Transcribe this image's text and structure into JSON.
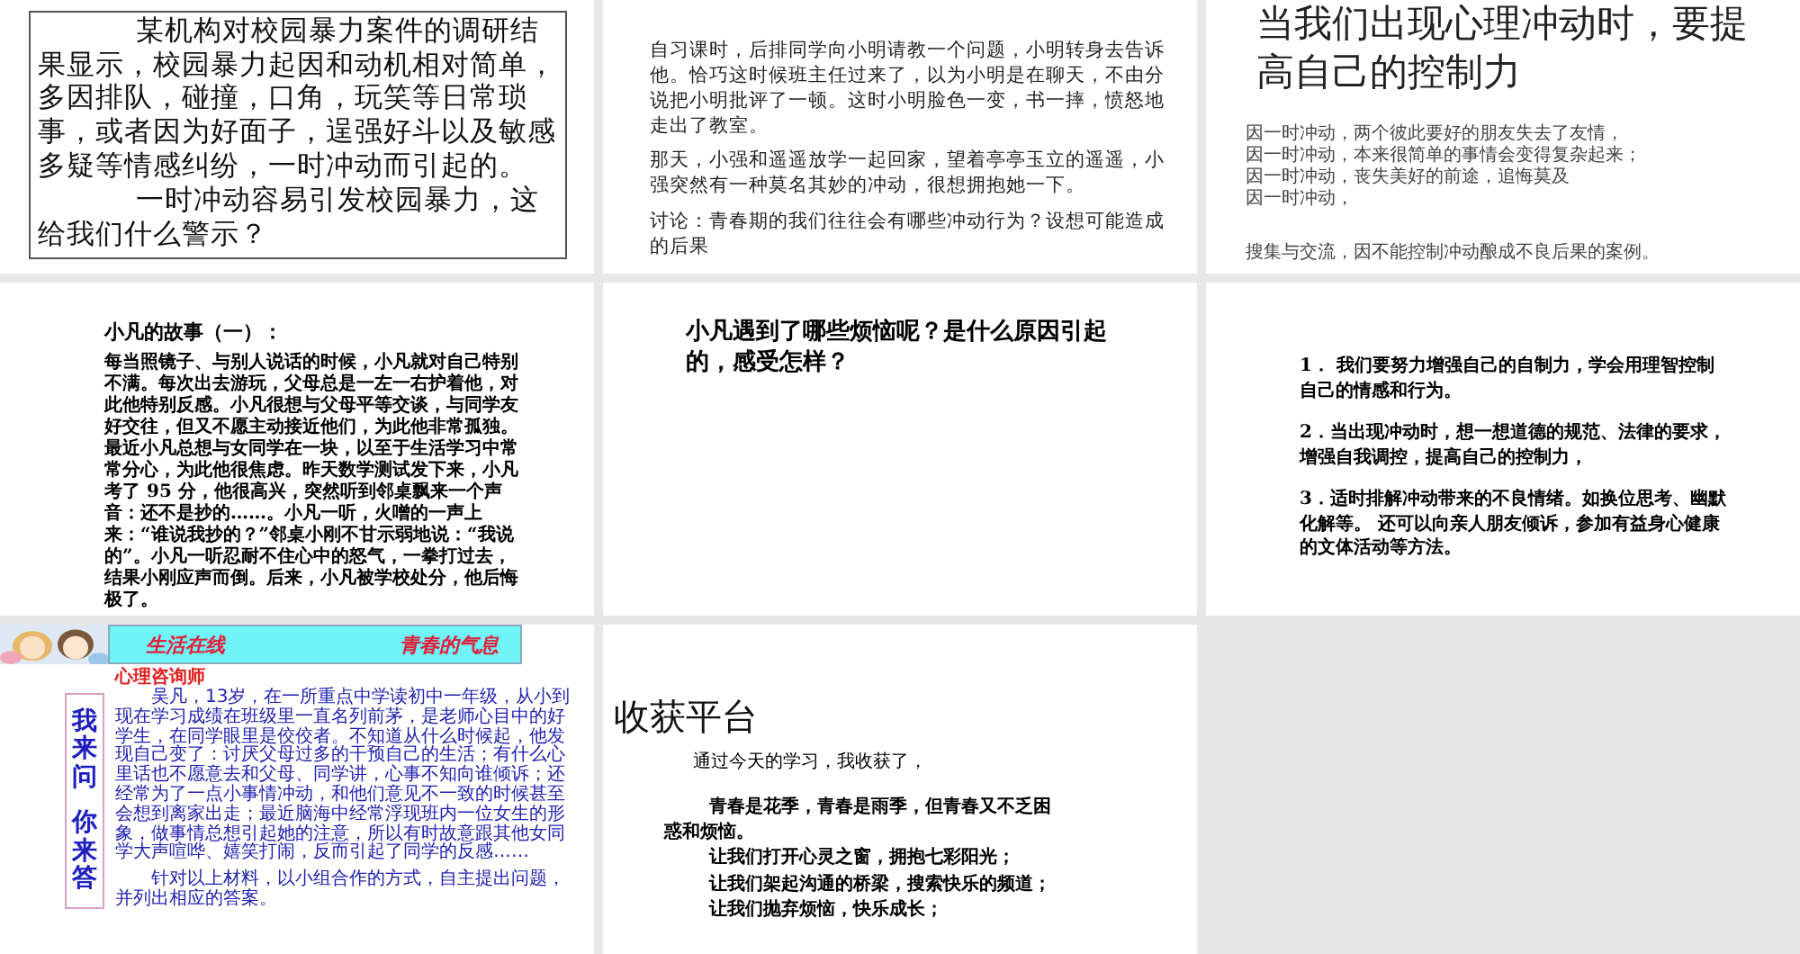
{
  "slides": [
    {
      "kind": "boxed",
      "paragraphs": [
        "某机构对校园暴力案件的调研结果显示，校园暴力起因和动机相对简单，多因排队，碰撞，口角，玩笑等日常琐事，或者因为好面子，逞强好斗以及敏感多疑等情感纠纷，一时冲动而引起的。",
        "一时冲动容易引发校园暴力，这给我们什么警示？"
      ]
    },
    {
      "kind": "text",
      "paragraphs": [
        "自习课时，后排同学向小明请教一个问题，小明转身去告诉他。恰巧这时候班主任过来了，以为小明是在聊天，不由分说把小明批评了一顿。这时小明脸色一变，书一摔，愤怒地走出了教室。",
        "那天，小强和遥遥放学一起回家，望着亭亭玉立的遥遥，小强突然有一种莫名其妙的冲动，很想拥抱她一下。",
        "讨论：青春期的我们往往会有哪些冲动行为？设想可能造成的后果"
      ]
    },
    {
      "kind": "titled",
      "title": "当我们出现心理冲动时，要提高自己的控制力",
      "lines": [
        "因一时冲动，两个彼此要好的朋友失去了友情，",
        "因一时冲动，本来很简单的事情会变得复杂起来；",
        "因一时冲动，丧失美好的前途，追悔莫及",
        "因一时冲动，"
      ],
      "note": "搜集与交流，因不能控制冲动酿成不良后果的案例。"
    },
    {
      "kind": "story",
      "title": "小凡的故事（一）：",
      "paragraphs": [
        "每当照镜子、与别人说话的时候，小凡就对自己特别不满。每次出去游玩，父母总是一左一右护着他，对此他特别反感。小凡很想与父母平等交谈，与同学友好交往，但又不愿主动接近他们，为此他非常孤独。最近小凡总想与女同学在一块，以至于生活学习中常常分心，为此他很焦虑。昨天数学测试发下来，小凡考了 95 分，他很高兴，突然听到邻桌飘来一个声音：还不是抄的……。小凡一听，火噌的一声上来：“谁说我抄的？”邻桌小刚不甘示弱地说：“我说的”。小凡一听忍耐不住心中的怒气，一拳打过去，结果小刚应声而倒。后来，小凡被学校处分，他后悔极了。"
      ]
    },
    {
      "kind": "question",
      "title": "小凡遇到了哪些烦恼呢？是什么原因引起的，感受怎样？"
    },
    {
      "kind": "list",
      "paragraphs": [
        "1． 我们要努力增强自己的自制力，学会用理智控制自己的情感和行为。",
        "2．当出现冲动时，想一想道德的规范、法律的要求，增强自我调控，提高自己的控制力，",
        "3．适时排解冲动带来的不良情绪。如换位思考、幽默化解等。 还可以向亲人朋友倾诉，参加有益身心健康的文体活动等方法。"
      ]
    },
    {
      "kind": "banner",
      "banner_left": "生活在线",
      "banner_right": "青春的气息",
      "subtitle": "心理咨询师",
      "side_labels": [
        "我来问",
        "你来答"
      ],
      "paragraphs": [
        "吴凡，13岁，在一所重点中学读初中一年级，从小到现在学习成绩在班级里一直名列前茅，是老师心目中的好学生，在同学眼里是佼佼者。不知道从什么时候起，他发现自己变了：讨厌父母过多的干预自己的生活；有什么心里话也不愿意去和父母、同学讲，心事不知向谁倾诉；还经常为了一点小事情冲动，和他们意见不一致的时候甚至会想到离家出走；最近脑海中经常浮现班内一位女生的形象，做事情总想引起她的注意，所以有时故意跟其他女同学大声喧哗、嬉笑打闹，反而引起了同学的反感……",
        "针对以上材料，以小组合作的方式，自主提出问题，并列出相应的答案。"
      ]
    },
    {
      "kind": "harvest",
      "title": "收获平台",
      "intro": "通过今天的学习，我收获了，",
      "lines": [
        "青春是花季，青春是雨季，但青春又不乏困惑和烦恼。",
        "让我们打开心灵之窗，拥抱七彩阳光；",
        "让我们架起沟通的桥梁，搜索快乐的频道；",
        "让我们抛弃烦恼，快乐成长；"
      ]
    }
  ]
}
